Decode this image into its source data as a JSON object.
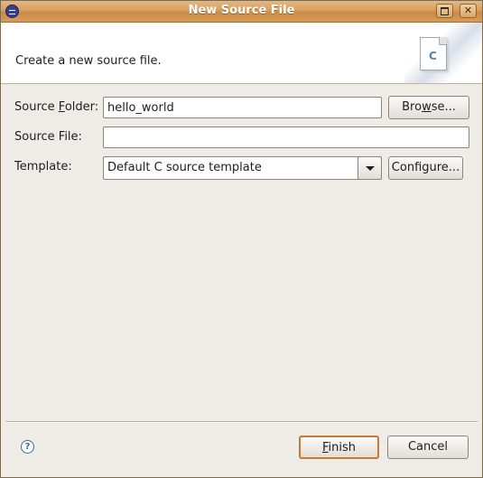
{
  "window": {
    "title": "New Source File"
  },
  "header": {
    "message": "Create a new source file.",
    "icon": "c-source-file-icon"
  },
  "form": {
    "source_folder": {
      "label_pre": "Source ",
      "label_mnemonic": "F",
      "label_post": "older:",
      "value": "hello_world"
    },
    "source_file": {
      "label": "Source File:",
      "value": ""
    },
    "template": {
      "label": "Template:",
      "selected": "Default C source template"
    },
    "browse": {
      "pre": "Bro",
      "mnemonic": "w",
      "post": "se..."
    },
    "configure_label": "Configure..."
  },
  "footer": {
    "finish": {
      "mnemonic": "F",
      "post": "inish"
    },
    "cancel_label": "Cancel",
    "help_glyph": "?"
  }
}
